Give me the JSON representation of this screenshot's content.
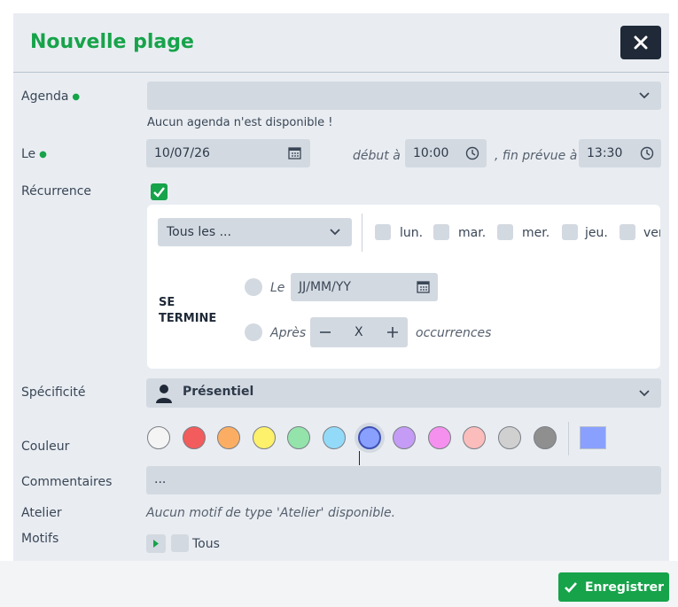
{
  "header": {
    "title": "Nouvelle plage"
  },
  "agenda": {
    "label": "Agenda",
    "value": "",
    "hint": "Aucun agenda n'est disponible !"
  },
  "date": {
    "label": "Le",
    "value": "10/07/26",
    "start_label": "début à",
    "start": "10:00",
    "end_label": ", fin prévue à",
    "end": "13:30"
  },
  "recurrence": {
    "label": "Récurrence",
    "checked": true,
    "frequency": "Tous les ...",
    "days": [
      {
        "label": "lun.",
        "checked": false
      },
      {
        "label": "mar.",
        "checked": false
      },
      {
        "label": "mer.",
        "checked": false
      },
      {
        "label": "jeu.",
        "checked": false
      },
      {
        "label": "ven.",
        "checked": false
      }
    ],
    "ends_label": "SE TERMINE",
    "end_on_label": "Le",
    "end_on_placeholder": "JJ/MM/YY",
    "after_label": "Après",
    "count_value": "X",
    "occurrences_label": "occurrences"
  },
  "specificity": {
    "label": "Spécificité",
    "value": "Présentiel"
  },
  "color": {
    "label": "Couleur",
    "swatches": [
      "#f4f4f4",
      "#f25c5c",
      "#fbae63",
      "#fdf06a",
      "#93e3ab",
      "#93daf8",
      "#8aa0ff",
      "#c59cf5",
      "#f590ee",
      "#fbbcbc",
      "#d0d0d0",
      "#8f8f8f"
    ],
    "selected_index": 6,
    "custom": "#8aa0ff"
  },
  "comments": {
    "label": "Commentaires",
    "value": "..."
  },
  "atelier": {
    "label": "Atelier",
    "text": "Aucun motif de type 'Atelier' disponible."
  },
  "motifs": {
    "label": "Motifs",
    "all_label": "Tous"
  },
  "footer": {
    "save_label": "Enregistrer"
  }
}
